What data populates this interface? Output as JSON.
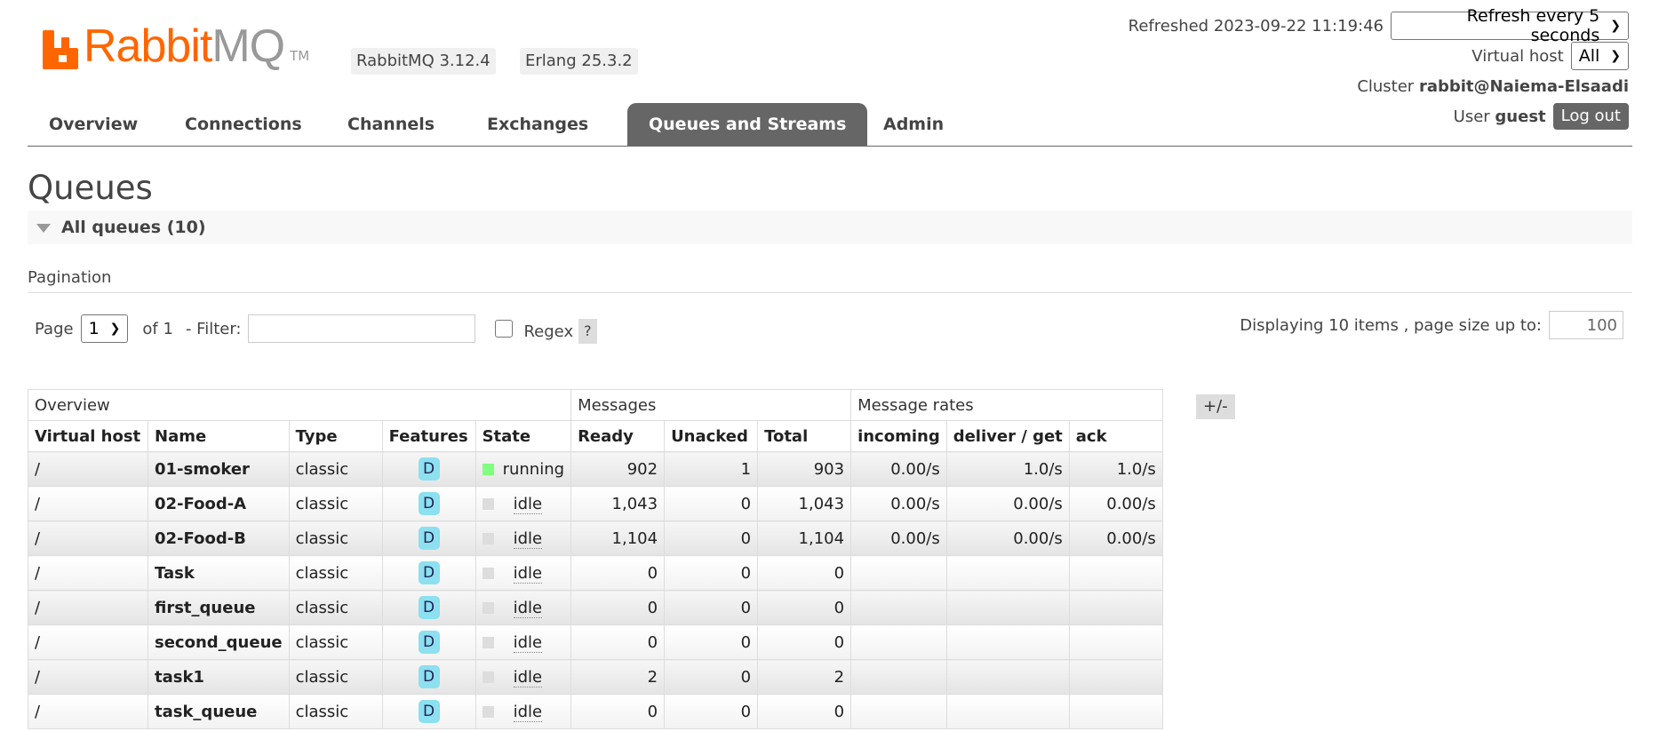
{
  "logo": {
    "word1": "Rabbit",
    "word2": "MQ",
    "tm": "TM"
  },
  "versions": {
    "rabbitmq": "RabbitMQ 3.12.4",
    "erlang": "Erlang 25.3.2"
  },
  "header": {
    "refreshed": "Refreshed 2023-09-22 11:19:46",
    "refresh_option": "Refresh every 5 seconds",
    "vhost_label": "Virtual host",
    "vhost_value": "All",
    "cluster_label": "Cluster",
    "cluster_name": "rabbit@Naiema-Elsaadi",
    "user_label": "User",
    "user_name": "guest",
    "logout_label": "Log out"
  },
  "tabs": [
    "Overview",
    "Connections",
    "Channels",
    "Exchanges",
    "Queues and Streams",
    "Admin"
  ],
  "active_tab": "Queues and Streams",
  "page_title": "Queues",
  "section_title": "All queues (10)",
  "pagination": {
    "label": "Pagination",
    "page_label": "Page",
    "page_value": "1",
    "of_text": "of 1",
    "filter_label": "- Filter:",
    "filter_value": "",
    "regex_label": "Regex",
    "help_label": "?",
    "display_text": "Displaying 10 items , page size up to:",
    "page_size": "100"
  },
  "table": {
    "groups": [
      "Overview",
      "Messages",
      "Message rates"
    ],
    "columns": [
      "Virtual host",
      "Name",
      "Type",
      "Features",
      "State",
      "Ready",
      "Unacked",
      "Total",
      "incoming",
      "deliver / get",
      "ack"
    ],
    "toggle_label": "+/-",
    "rows": [
      {
        "vhost": "/",
        "name": "01-smoker",
        "type": "classic",
        "feature": "D",
        "state": "running",
        "ready": "902",
        "unacked": "1",
        "total": "903",
        "incoming": "0.00/s",
        "deliver": "1.0/s",
        "ack": "1.0/s"
      },
      {
        "vhost": "/",
        "name": "02-Food-A",
        "type": "classic",
        "feature": "D",
        "state": "idle",
        "ready": "1,043",
        "unacked": "0",
        "total": "1,043",
        "incoming": "0.00/s",
        "deliver": "0.00/s",
        "ack": "0.00/s"
      },
      {
        "vhost": "/",
        "name": "02-Food-B",
        "type": "classic",
        "feature": "D",
        "state": "idle",
        "ready": "1,104",
        "unacked": "0",
        "total": "1,104",
        "incoming": "0.00/s",
        "deliver": "0.00/s",
        "ack": "0.00/s"
      },
      {
        "vhost": "/",
        "name": "Task",
        "type": "classic",
        "feature": "D",
        "state": "idle",
        "ready": "0",
        "unacked": "0",
        "total": "0",
        "incoming": "",
        "deliver": "",
        "ack": ""
      },
      {
        "vhost": "/",
        "name": "first_queue",
        "type": "classic",
        "feature": "D",
        "state": "idle",
        "ready": "0",
        "unacked": "0",
        "total": "0",
        "incoming": "",
        "deliver": "",
        "ack": ""
      },
      {
        "vhost": "/",
        "name": "second_queue",
        "type": "classic",
        "feature": "D",
        "state": "idle",
        "ready": "0",
        "unacked": "0",
        "total": "0",
        "incoming": "",
        "deliver": "",
        "ack": ""
      },
      {
        "vhost": "/",
        "name": "task1",
        "type": "classic",
        "feature": "D",
        "state": "idle",
        "ready": "2",
        "unacked": "0",
        "total": "2",
        "incoming": "",
        "deliver": "",
        "ack": ""
      },
      {
        "vhost": "/",
        "name": "task_queue",
        "type": "classic",
        "feature": "D",
        "state": "idle",
        "ready": "0",
        "unacked": "0",
        "total": "0",
        "incoming": "",
        "deliver": "",
        "ack": ""
      }
    ]
  }
}
